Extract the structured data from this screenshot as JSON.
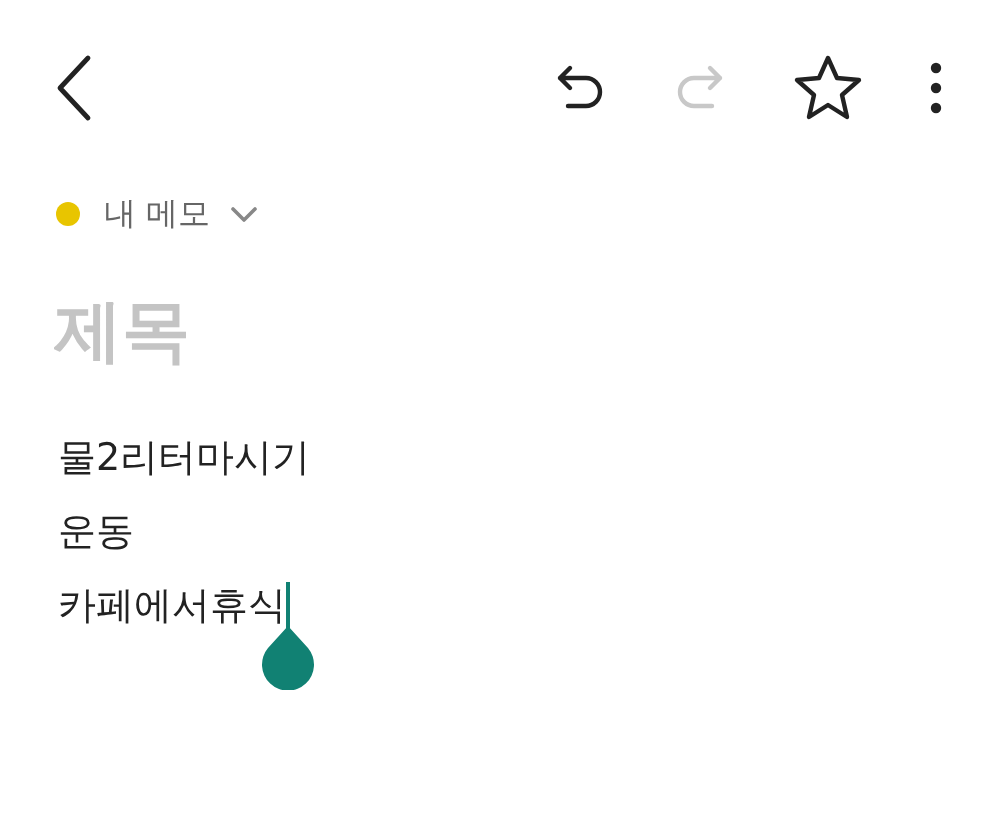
{
  "toolbar": {
    "actions": [
      {
        "kind": "undo",
        "disabled": false
      },
      {
        "kind": "redo",
        "disabled": true
      },
      {
        "kind": "star",
        "disabled": false
      },
      {
        "kind": "more",
        "disabled": false
      }
    ]
  },
  "folder": {
    "label": "내 메모",
    "color": "#e8c500"
  },
  "title": {
    "placeholder": "제목"
  },
  "body": {
    "lines": [
      "물2리터마시기",
      "운동",
      "카페에서휴식"
    ]
  }
}
